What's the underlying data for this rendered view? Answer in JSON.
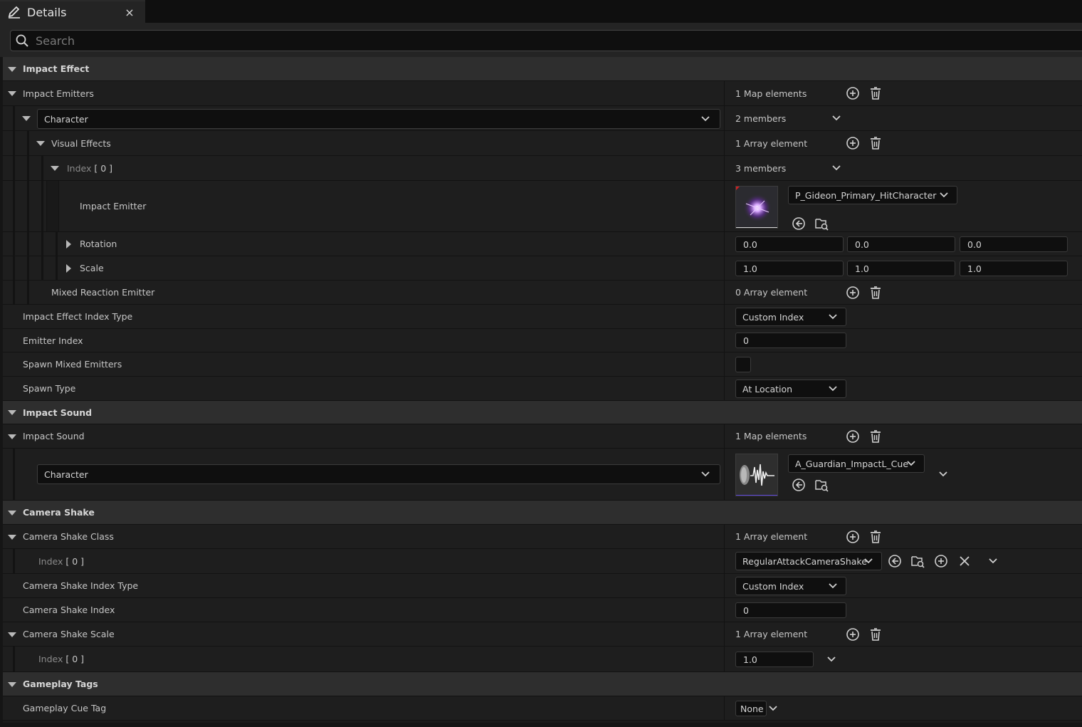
{
  "tab": {
    "title": "Details",
    "close": "×",
    "icon": "pencil-icon"
  },
  "search": {
    "placeholder": "Search",
    "icon": "search-icon"
  },
  "labels": {
    "impact_effect": "Impact Effect",
    "impact_emitters": "Impact Emitters",
    "visual_effects": "Visual Effects",
    "index0": "Index",
    "index0_num": "[ 0 ]",
    "impact_emitter": "Impact Emitter",
    "rotation": "Rotation",
    "scale": "Scale",
    "mixed_reaction_emitter": "Mixed Reaction Emitter",
    "impact_effect_index_type": "Impact Effect Index Type",
    "emitter_index": "Emitter Index",
    "spawn_mixed_emitters": "Spawn Mixed Emitters",
    "spawn_type": "Spawn Type",
    "impact_sound_cat": "Impact Sound",
    "impact_sound": "Impact Sound",
    "camera_shake": "Camera Shake",
    "camera_shake_class": "Camera Shake Class",
    "camera_shake_index_type": "Camera Shake Index Type",
    "camera_shake_index": "Camera Shake Index",
    "camera_shake_scale": "Camera Shake Scale",
    "gameplay_tags": "Gameplay Tags",
    "gameplay_cue_tag": "Gameplay Cue Tag"
  },
  "values": {
    "impact_emitters_count": "1 Map elements",
    "character_key": "Character",
    "character_members": "2 members",
    "visual_effects_count": "1 Array element",
    "index0_members": "3 members",
    "emitter_asset": "P_Gideon_Primary_HitCharacter",
    "rotation": [
      "0.0",
      "0.0",
      "0.0"
    ],
    "scale": [
      "1.0",
      "1.0",
      "1.0"
    ],
    "mixed_count": "0 Array element",
    "index_type": "Custom Index",
    "emitter_index": "0",
    "spawn_type": "At Location",
    "impact_sound_count": "1 Map elements",
    "sound_key": "Character",
    "sound_asset": "A_Guardian_ImpactL_Cue",
    "camera_shake_class_count": "1 Array element",
    "camera_shake_asset": "RegularAttackCameraShake",
    "camera_shake_index_type": "Custom Index",
    "camera_shake_index": "0",
    "camera_shake_scale_count": "1 Array element",
    "camera_shake_scale_0": "1.0",
    "gameplay_cue_tag": "None"
  },
  "colors": {
    "accent_purple": "#b070ff",
    "panel": "#1e1e1e",
    "category": "#2e2e2e"
  }
}
